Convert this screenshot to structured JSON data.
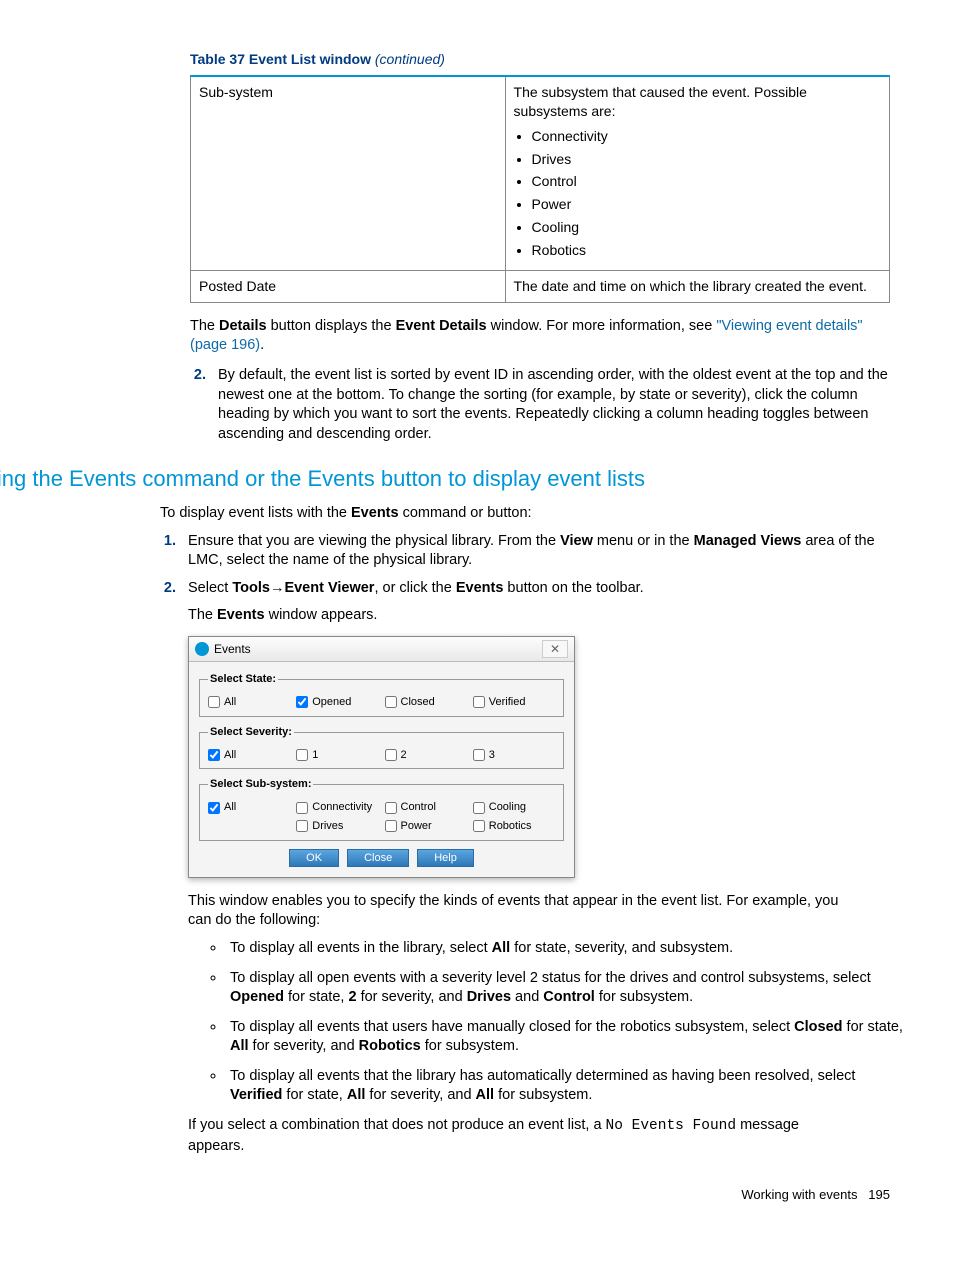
{
  "caption": {
    "label": "Table 37 Event List window",
    "cont": "(continued)"
  },
  "table": {
    "rows": [
      {
        "left": "Sub-system",
        "intro": "The subsystem that caused the event. Possible subsystems are:",
        "items": [
          "Connectivity",
          "Drives",
          "Control",
          "Power",
          "Cooling",
          "Robotics"
        ]
      },
      {
        "left": "Posted Date",
        "right": "The date and time on which the library created the event."
      }
    ]
  },
  "p1": {
    "t1": "The ",
    "b1": "Details",
    "t2": " button displays the ",
    "b2": "Event Details",
    "t3": " window. For more information, see ",
    "link": "\"Viewing event details\" (page 196)",
    "t4": "."
  },
  "step2a": "By default, the event list is sorted by event ID in ascending order, with the oldest event at the top and the newest one at the bottom. To change the sorting (for example, by state or severity), click the column heading by which you want to sort the events. Repeatedly clicking a column heading toggles between ascending and descending order.",
  "h2": "Using the Events command or the Events button to display event lists",
  "intro2": {
    "t1": "To display event lists with the ",
    "b1": "Events",
    "t2": " command or button:"
  },
  "step1b": {
    "t1": "Ensure that you are viewing the physical library. From the ",
    "b1": "View",
    "t2": " menu or in the ",
    "b2": "Managed Views",
    "t3": " area of the LMC, select the name of the physical library."
  },
  "step2b": {
    "t1": "Select ",
    "b1": "Tools",
    "arrow": "→",
    "b2": "Event Viewer",
    "t2": ", or click the ",
    "b3": "Events",
    "t3": " button on the toolbar."
  },
  "sub2b": {
    "t1": "The ",
    "b1": "Events",
    "t2": " window appears."
  },
  "dialog": {
    "title": "Events",
    "fs1": {
      "legend": "Select State:",
      "opts": [
        {
          "label": "All",
          "checked": false
        },
        {
          "label": "Opened",
          "checked": true
        },
        {
          "label": "Closed",
          "checked": false
        },
        {
          "label": "Verified",
          "checked": false
        }
      ]
    },
    "fs2": {
      "legend": "Select Severity:",
      "opts": [
        {
          "label": "All",
          "checked": true
        },
        {
          "label": "1",
          "checked": false
        },
        {
          "label": "2",
          "checked": false
        },
        {
          "label": "3",
          "checked": false
        }
      ]
    },
    "fs3": {
      "legend": "Select Sub-system:",
      "col1": [
        {
          "label": "All",
          "checked": true
        }
      ],
      "col2": [
        {
          "label": "Connectivity",
          "checked": false
        },
        {
          "label": "Drives",
          "checked": false
        }
      ],
      "col3": [
        {
          "label": "Control",
          "checked": false
        },
        {
          "label": "Power",
          "checked": false
        }
      ],
      "col4": [
        {
          "label": "Cooling",
          "checked": false
        },
        {
          "label": "Robotics",
          "checked": false
        }
      ]
    },
    "buttons": [
      "OK",
      "Close",
      "Help"
    ]
  },
  "p_after": "This window enables you to specify the kinds of events that appear in the event list. For example, you can do the following:",
  "bullets": [
    {
      "t1": "To display all events in the library, select ",
      "b1": "All",
      "t2": " for state, severity, and subsystem."
    },
    {
      "t1": "To display all open events with a severity level 2 status for the drives and control subsystems, select ",
      "b1": "Opened",
      "t2": " for state, ",
      "b2": "2",
      "t3": " for severity, and ",
      "b3": "Drives",
      "t4": " and ",
      "b4": "Control",
      "t5": " for subsystem."
    },
    {
      "t1": "To display all events that users have manually closed for the robotics subsystem, select ",
      "b1": "Closed",
      "t2": " for state, ",
      "b2": "All",
      "t3": " for severity, and ",
      "b3": "Robotics",
      "t4": " for subsystem."
    },
    {
      "t1": "To display all events that the library has automatically determined as having been resolved, select ",
      "b1": "Verified",
      "t2": " for state, ",
      "b2": "All",
      "t3": " for severity, and ",
      "b3": "All",
      "t4": " for subsystem."
    }
  ],
  "p_last": {
    "t1": "If you select a combination that does not produce an event list, a ",
    "mono": "No Events Found",
    "t2": " message appears."
  },
  "footer": {
    "label": "Working with events",
    "page": "195"
  }
}
